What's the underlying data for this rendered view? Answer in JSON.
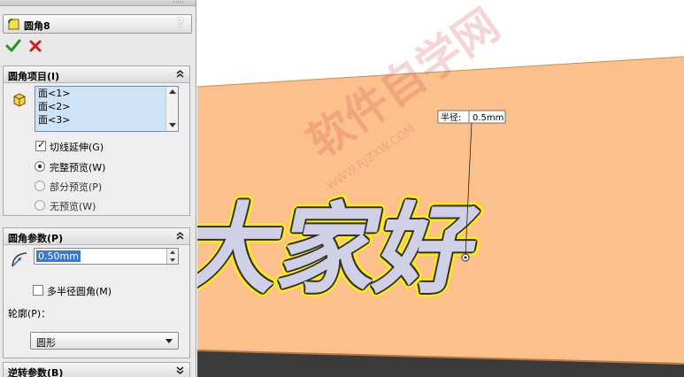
{
  "panel": {
    "feature_title": "圆角8",
    "help_glyph": "?",
    "ok_icon": "check-icon",
    "cancel_icon": "cross-icon"
  },
  "fillet_items": {
    "title": "圆角项目(I)",
    "faces": [
      "面<1>",
      "面<2>",
      "面<3>"
    ],
    "tangent_propagation": {
      "label": "切线延伸(G)",
      "checked": true
    },
    "preview_options": [
      {
        "label": "完整预览(W)",
        "selected": true
      },
      {
        "label": "部分预览(P)",
        "selected": false
      },
      {
        "label": "无预览(W)",
        "selected": false
      }
    ]
  },
  "fillet_params": {
    "title": "圆角参数(P)",
    "radius_value": "0.50mm",
    "multi_radius": {
      "label": "多半径圆角(M)",
      "checked": false
    },
    "profile_label": "轮廓(P)：",
    "profile_value": "圆形"
  },
  "setback_params": {
    "title": "逆转参数(B)"
  },
  "viewport": {
    "text_3d": "大家好",
    "watermark": "软件自学网",
    "watermark_url": "WWW.RJZXW.COM",
    "dimension_label": "半径:",
    "dimension_value": "0.5mm",
    "colors": {
      "plate": "#fbc08c",
      "plate_edge": "#c98d58",
      "letters": "#cfd0e6",
      "highlight": "#ffee00"
    }
  }
}
